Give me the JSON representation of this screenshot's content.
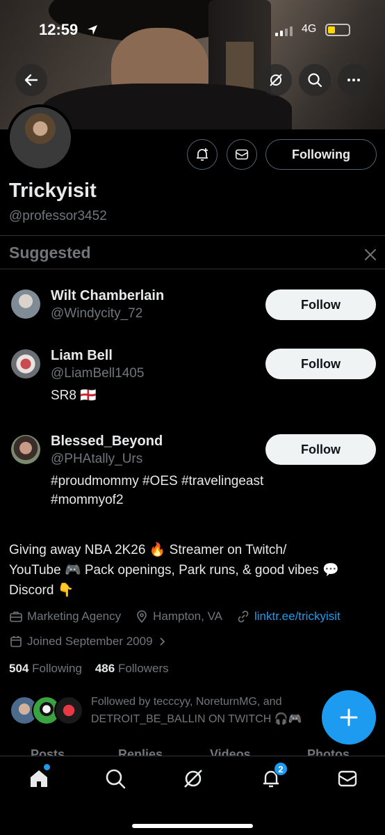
{
  "status_bar": {
    "time": "12:59",
    "network": "4G"
  },
  "profile": {
    "display_name": "Trickyisit",
    "handle": "@professor3452",
    "following_button": "Following",
    "bio_line1": "Giving away NBA 2K26 🔥 Streamer on Twitch/",
    "bio_line2": "YouTube 🎮 Pack openings, Park runs, & good vibes 💬",
    "bio_line3": "Discord 👇",
    "category": "Marketing Agency",
    "location": "Hampton, VA",
    "link": "linktr.ee/trickyisit",
    "joined": "Joined September 2009",
    "following_count": "504",
    "following_label": "Following",
    "followers_count": "486",
    "followers_label": "Followers",
    "followed_by_line1": "Followed by tecccyy, NoreturnMG, and",
    "followed_by_line2": "DETROIT_BE_BALLIN ON TWITCH 🎧🎮"
  },
  "suggested": {
    "title": "Suggested",
    "users": [
      {
        "name": "Wilt Chamberlain",
        "handle": "@Windycity_72",
        "bio1": "",
        "bio2": "",
        "button": "Follow"
      },
      {
        "name": "Liam Bell",
        "handle": "@LiamBell1405",
        "bio1": "SR8 🏴󠁧󠁢󠁥󠁮󠁧󠁿",
        "bio2": "",
        "button": "Follow"
      },
      {
        "name": "Blessed_Beyond",
        "handle": "@PHAtally_Urs",
        "bio1": "#proudmommy #OES #travelingeast",
        "bio2": "#mommyof2",
        "button": "Follow"
      }
    ]
  },
  "tabs": [
    "Posts",
    "Replies",
    "Videos",
    "Photos"
  ],
  "nav": {
    "notifications_badge": "2"
  },
  "colors": {
    "accent": "#1d9bf0",
    "background": "#000000",
    "muted": "#71767b"
  }
}
